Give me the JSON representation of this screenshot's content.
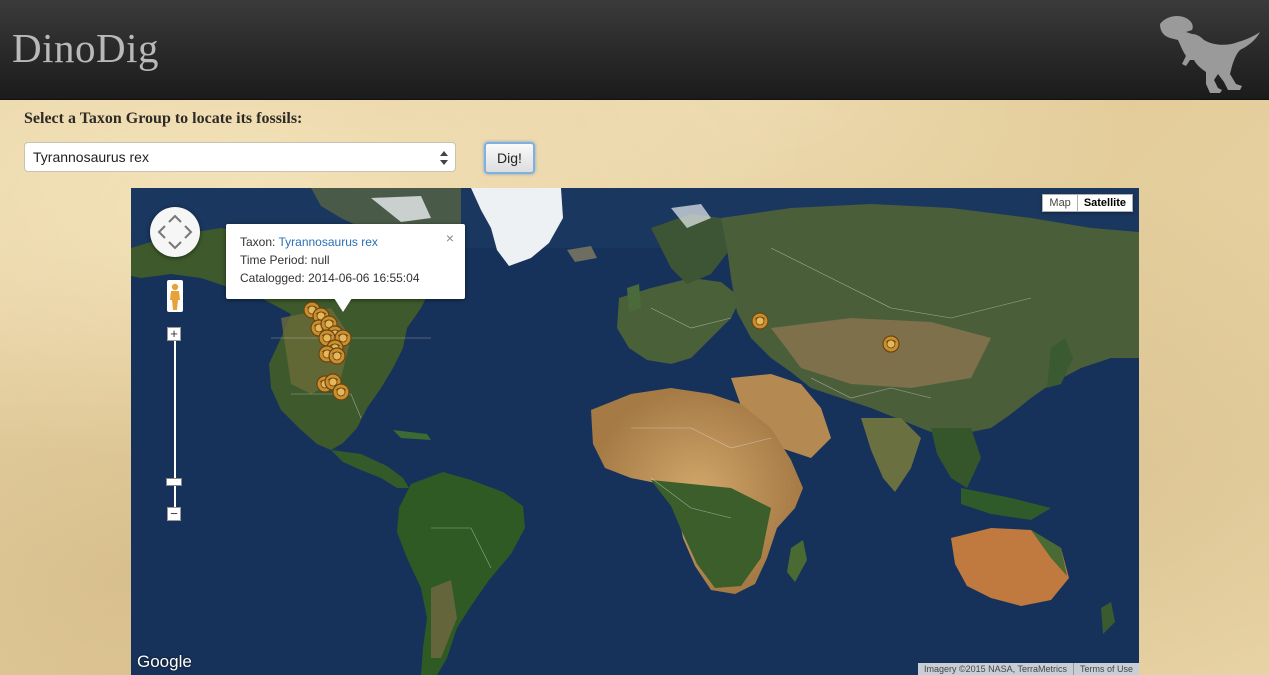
{
  "header": {
    "brand": "DinoDig",
    "logo_icon": "trex-silhouette-icon"
  },
  "form": {
    "prompt": "Select a Taxon Group to locate its fossils:",
    "select_value": "Tyrannosaurus rex",
    "button_label": "Dig!"
  },
  "map": {
    "type_map": "Map",
    "type_satellite": "Satellite",
    "active_type": "Satellite",
    "zoom_in": "+",
    "zoom_out": "−",
    "logo": "Google",
    "imagery_credit": "Imagery ©2015 NASA, TerraMetrics",
    "terms": "Terms of Use",
    "marker_icon": "fossil-marker-icon",
    "info": {
      "taxon_label": "Taxon:",
      "taxon_value": "Tyrannosaurus rex",
      "period_label": "Time Period:",
      "period_value": "null",
      "catalogued_label": "Catalogged:",
      "catalogued_value": "2014-06-06 16:55:04",
      "close": "×"
    }
  },
  "colors": {
    "header": "#2a2a2a",
    "parchment": "#e6d2a4",
    "ocean": "#17325a",
    "land": "#3e5a2c",
    "desert": "#c49a5a",
    "ice": "#f2f4f6",
    "marker": "#c9902f",
    "link": "#2a6fb5"
  }
}
